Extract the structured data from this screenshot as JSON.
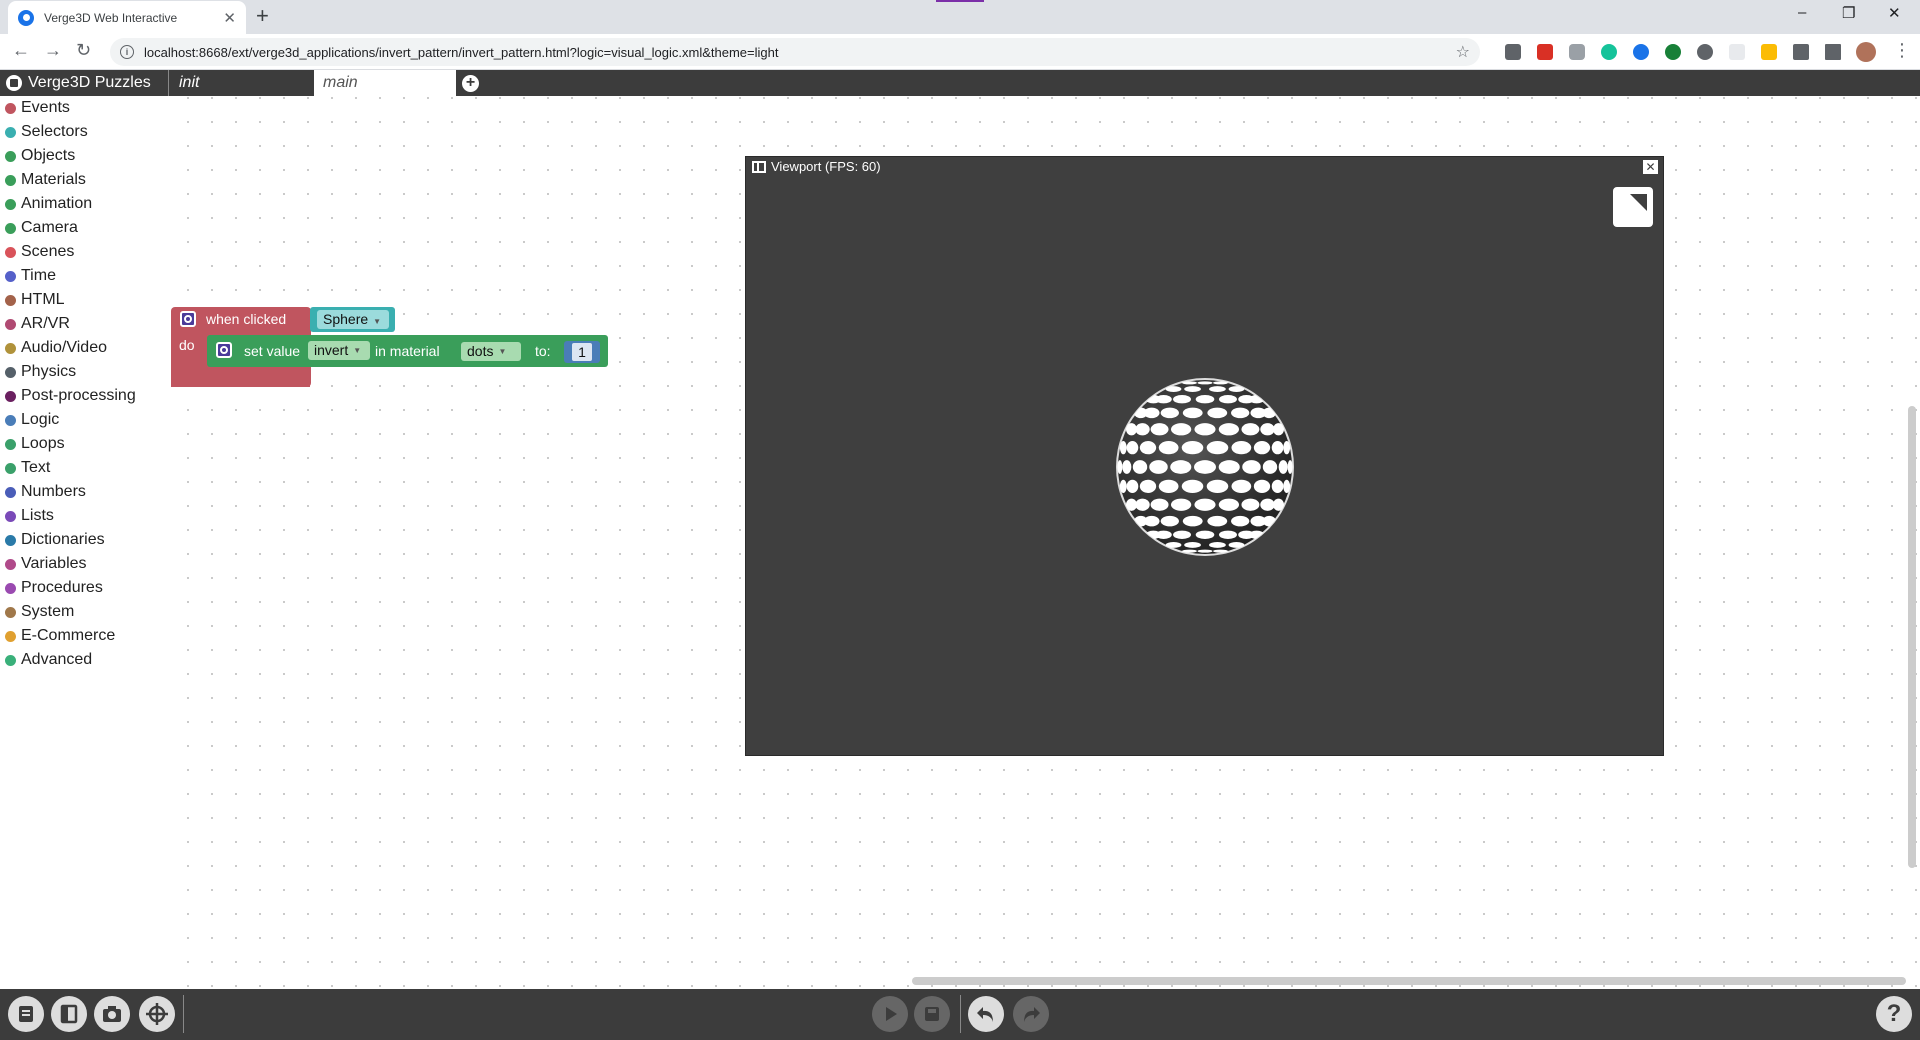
{
  "browser": {
    "tab_title": "Verge3D Web Interactive",
    "tab_close": "✕",
    "new_tab": "+",
    "url": "localhost:8668/ext/verge3d_applications/invert_pattern/invert_pattern.html?logic=visual_logic.xml&theme=light",
    "window_controls": [
      "–",
      "❐",
      "✕"
    ]
  },
  "app": {
    "name": "Verge3D Puzzles",
    "tabs": [
      {
        "label": "init",
        "active": false
      },
      {
        "label": "main",
        "active": true
      }
    ],
    "add_tab": "+"
  },
  "toolbox": {
    "categories": [
      {
        "label": "Events",
        "color": "#c0555f"
      },
      {
        "label": "Selectors",
        "color": "#3aafb0"
      },
      {
        "label": "Objects",
        "color": "#3a9e5a"
      },
      {
        "label": "Materials",
        "color": "#3a9e5a"
      },
      {
        "label": "Animation",
        "color": "#3a9e5a"
      },
      {
        "label": "Camera",
        "color": "#3a9e5a"
      },
      {
        "label": "Scenes",
        "color": "#d9535a"
      },
      {
        "label": "Time",
        "color": "#5560c9"
      },
      {
        "label": "HTML",
        "color": "#a3624a"
      },
      {
        "label": "AR/VR",
        "color": "#b04a72"
      },
      {
        "label": "Audio/Video",
        "color": "#b0923a"
      },
      {
        "label": "Physics",
        "color": "#556069"
      },
      {
        "label": "Post-processing",
        "color": "#6a2060"
      },
      {
        "label": "Logic",
        "color": "#4a7db8"
      },
      {
        "label": "Loops",
        "color": "#3aa06a"
      },
      {
        "label": "Text",
        "color": "#3aa06a"
      },
      {
        "label": "Numbers",
        "color": "#4a5db8"
      },
      {
        "label": "Lists",
        "color": "#7a4ab8"
      },
      {
        "label": "Dictionaries",
        "color": "#2a7aa8"
      },
      {
        "label": "Variables",
        "color": "#b04a8a"
      },
      {
        "label": "Procedures",
        "color": "#9a4ab0"
      },
      {
        "label": "System",
        "color": "#a0784a"
      },
      {
        "label": "E-Commerce",
        "color": "#e0a030"
      },
      {
        "label": "Advanced",
        "color": "#3ab07a"
      }
    ]
  },
  "puzzles": {
    "event_label": "when clicked",
    "event_object": "Sphere",
    "do_label": "do",
    "set_label": "set value",
    "set_param": "invert",
    "in_material_label": "in material",
    "material": "dots",
    "to_label": "to:",
    "value": "1"
  },
  "viewport": {
    "title": "Viewport (FPS: 60)",
    "close": "✕"
  },
  "bottom_toolbar": {
    "left_buttons": [
      "file-menu",
      "layout",
      "screenshot",
      "target"
    ],
    "center_buttons": [
      "run",
      "save",
      "undo",
      "redo"
    ],
    "help": "?"
  }
}
